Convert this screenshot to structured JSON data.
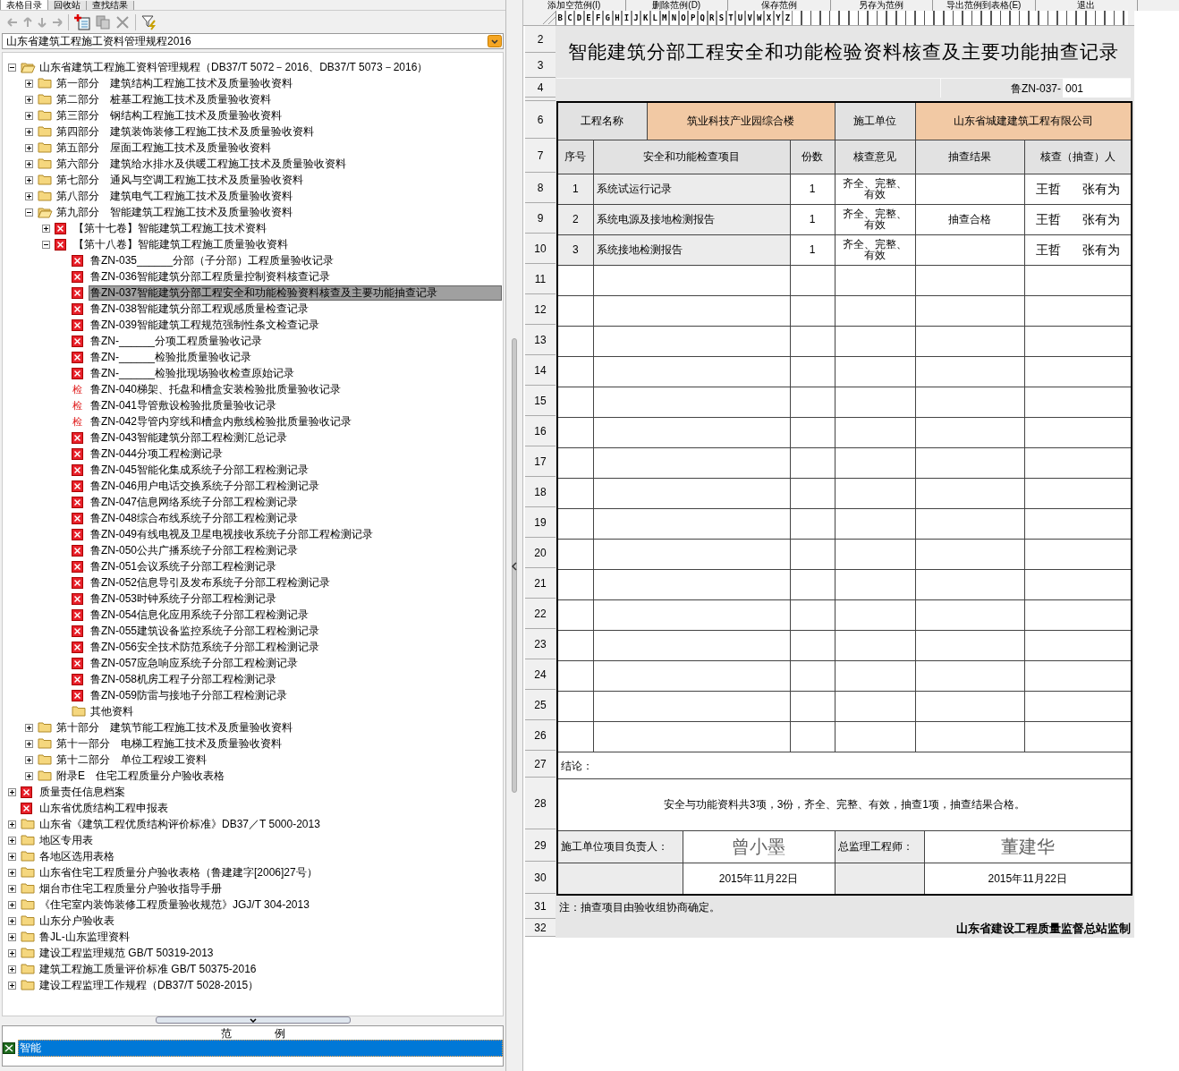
{
  "left_tabs": [
    {
      "label": "表格目录",
      "selected": true
    },
    {
      "label": "回收站",
      "selected": false
    },
    {
      "label": "查找结果",
      "selected": false
    }
  ],
  "standard_select": {
    "value": "山东省建筑工程施工资料管理规程2016"
  },
  "tree": [
    {
      "label": "山东省建筑工程施工资料管理规程（DB37/T 5072－2016、DB37/T 5073－2016）",
      "kind": "folder",
      "expanded": true,
      "selected": false,
      "children": [
        {
          "label": "第一部分　建筑结构工程施工技术及质量验收资料",
          "kind": "folder",
          "expanded": false,
          "selected": false
        },
        {
          "label": "第二部分　桩基工程施工技术及质量验收资料",
          "kind": "folder",
          "expanded": false,
          "selected": false
        },
        {
          "label": "第三部分　钢结构工程施工技术及质量验收资料",
          "kind": "folder",
          "expanded": false,
          "selected": false
        },
        {
          "label": "第四部分　建筑装饰装修工程施工技术及质量验收资料",
          "kind": "folder",
          "expanded": false,
          "selected": false
        },
        {
          "label": "第五部分　屋面工程施工技术及质量验收资料",
          "kind": "folder",
          "expanded": false,
          "selected": false
        },
        {
          "label": "第六部分　建筑给水排水及供暖工程施工技术及质量验收资料",
          "kind": "folder",
          "expanded": false,
          "selected": false
        },
        {
          "label": "第七部分　通风与空调工程施工技术及质量验收资料",
          "kind": "folder",
          "expanded": false,
          "selected": false
        },
        {
          "label": "第八部分　建筑电气工程施工技术及质量验收资料",
          "kind": "folder",
          "expanded": false,
          "selected": false
        },
        {
          "label": "第九部分　智能建筑工程施工技术及质量验收资料",
          "kind": "folder",
          "expanded": true,
          "selected": false,
          "children": [
            {
              "label": "【第十七卷】智能建筑工程施工技术资料",
              "kind": "form",
              "expanded": false,
              "selected": false
            },
            {
              "label": "【第十八卷】智能建筑工程施工质量验收资料",
              "kind": "form",
              "expanded": true,
              "selected": false,
              "children": [
                {
                  "label": "鲁ZN-035______分部（子分部）工程质量验收记录",
                  "kind": "form",
                  "selected": false
                },
                {
                  "label": "鲁ZN-036智能建筑分部工程质量控制资料核查记录",
                  "kind": "form",
                  "selected": false
                },
                {
                  "label": "鲁ZN-037智能建筑分部工程安全和功能检验资料核查及主要功能抽查记录",
                  "kind": "form",
                  "selected": true
                },
                {
                  "label": "鲁ZN-038智能建筑分部工程观感质量检查记录",
                  "kind": "form",
                  "selected": false
                },
                {
                  "label": "鲁ZN-039智能建筑工程规范强制性条文检查记录",
                  "kind": "form",
                  "selected": false
                },
                {
                  "label": "鲁ZN-______分项工程质量验收记录",
                  "kind": "form",
                  "selected": false
                },
                {
                  "label": "鲁ZN-______检验批质量验收记录",
                  "kind": "form",
                  "selected": false
                },
                {
                  "label": "鲁ZN-______检验批现场验收检查原始记录",
                  "kind": "form",
                  "selected": false
                },
                {
                  "label": "鲁ZN-040梯架、托盘和槽盒安装检验批质量验收记录",
                  "kind": "inspect",
                  "glyph": "检",
                  "selected": false
                },
                {
                  "label": "鲁ZN-041导管敷设检验批质量验收记录",
                  "kind": "inspect",
                  "glyph": "检",
                  "selected": false
                },
                {
                  "label": "鲁ZN-042导管内穿线和槽盒内敷线检验批质量验收记录",
                  "kind": "inspect",
                  "glyph": "检",
                  "selected": false
                },
                {
                  "label": "鲁ZN-043智能建筑分部工程检测汇总记录",
                  "kind": "form",
                  "selected": false
                },
                {
                  "label": "鲁ZN-044分项工程检测记录",
                  "kind": "form",
                  "selected": false
                },
                {
                  "label": "鲁ZN-045智能化集成系统子分部工程检测记录",
                  "kind": "form",
                  "selected": false
                },
                {
                  "label": "鲁ZN-046用户电话交换系统子分部工程检测记录",
                  "kind": "form",
                  "selected": false
                },
                {
                  "label": "鲁ZN-047信息网络系统子分部工程检测记录",
                  "kind": "form",
                  "selected": false
                },
                {
                  "label": "鲁ZN-048综合布线系统子分部工程检测记录",
                  "kind": "form",
                  "selected": false
                },
                {
                  "label": "鲁ZN-049有线电视及卫星电视接收系统子分部工程检测记录",
                  "kind": "form",
                  "selected": false
                },
                {
                  "label": "鲁ZN-050公共广播系统子分部工程检测记录",
                  "kind": "form",
                  "selected": false
                },
                {
                  "label": "鲁ZN-051会议系统子分部工程检测记录",
                  "kind": "form",
                  "selected": false
                },
                {
                  "label": "鲁ZN-052信息导引及发布系统子分部工程检测记录",
                  "kind": "form",
                  "selected": false
                },
                {
                  "label": "鲁ZN-053时钟系统子分部工程检测记录",
                  "kind": "form",
                  "selected": false
                },
                {
                  "label": "鲁ZN-054信息化应用系统子分部工程检测记录",
                  "kind": "form",
                  "selected": false
                },
                {
                  "label": "鲁ZN-055建筑设备监控系统子分部工程检测记录",
                  "kind": "form",
                  "selected": false
                },
                {
                  "label": "鲁ZN-056安全技术防范系统子分部工程检测记录",
                  "kind": "form",
                  "selected": false
                },
                {
                  "label": "鲁ZN-057应急响应系统子分部工程检测记录",
                  "kind": "form",
                  "selected": false
                },
                {
                  "label": "鲁ZN-058机房工程子分部工程检测记录",
                  "kind": "form",
                  "selected": false
                },
                {
                  "label": "鲁ZN-059防雷与接地子分部工程检测记录",
                  "kind": "form",
                  "selected": false
                },
                {
                  "label": "其他资料",
                  "kind": "folder",
                  "selected": false
                }
              ]
            }
          ]
        },
        {
          "label": "第十部分　建筑节能工程施工技术及质量验收资料",
          "kind": "folder",
          "expanded": false,
          "selected": false
        },
        {
          "label": "第十一部分　电梯工程施工技术及质量验收资料",
          "kind": "folder",
          "expanded": false,
          "selected": false
        },
        {
          "label": "第十二部分　单位工程竣工资料",
          "kind": "folder",
          "expanded": false,
          "selected": false
        },
        {
          "label": "附录E　住宅工程质量分户验收表格",
          "kind": "folder",
          "expanded": false,
          "selected": false
        }
      ]
    },
    {
      "label": "质量责任信息档案",
      "kind": "form",
      "expanded": false,
      "selected": false
    },
    {
      "label": "山东省优质结构工程申报表",
      "kind": "form",
      "selected": false
    },
    {
      "label": "山东省《建筑工程优质结构评价标准》DB37／T 5000-2013",
      "kind": "folder",
      "expanded": false,
      "selected": false
    },
    {
      "label": "地区专用表",
      "kind": "folder",
      "expanded": false,
      "selected": false
    },
    {
      "label": "各地区选用表格",
      "kind": "folder",
      "expanded": false,
      "selected": false
    },
    {
      "label": "山东省住宅工程质量分户验收表格（鲁建建字[2006]27号）",
      "kind": "folder",
      "expanded": false,
      "selected": false
    },
    {
      "label": "烟台市住宅工程质量分户验收指导手册",
      "kind": "folder",
      "expanded": false,
      "selected": false
    },
    {
      "label": "《住宅室内装饰装修工程质量验收规范》JGJ/T 304-2013",
      "kind": "folder",
      "expanded": false,
      "selected": false
    },
    {
      "label": "山东分户验收表",
      "kind": "folder",
      "expanded": false,
      "selected": false
    },
    {
      "label": "鲁JL-山东监理资料",
      "kind": "folder",
      "expanded": false,
      "selected": false
    },
    {
      "label": "建设工程监理规范 GB/T 50319-2013",
      "kind": "folder",
      "expanded": false,
      "selected": false
    },
    {
      "label": "建筑工程施工质量评价标准 GB/T 50375-2016",
      "kind": "folder",
      "expanded": false,
      "selected": false
    },
    {
      "label": "建设工程监理工作规程（DB37/T 5028-2015）",
      "kind": "folder",
      "expanded": false,
      "selected": false
    }
  ],
  "legend": {
    "title": "范　　　　例",
    "items": [
      {
        "label": "智能",
        "selected": true
      }
    ]
  },
  "sample_buttons": [
    "添加空范例(I)",
    "删除范例(D)",
    "保存范例",
    "另存为范例",
    "导出范例到表格(E)",
    "退出"
  ],
  "column_letters": [
    "B",
    "C",
    "D",
    "E",
    "F",
    "G",
    "H",
    "I",
    "J",
    "K",
    "L",
    "M",
    "N",
    "O",
    "P",
    "Q",
    "R",
    "S",
    "T",
    "U",
    "V",
    "W",
    "X",
    "Y",
    "Z"
  ],
  "row_numbers": [
    "2",
    "3",
    "4",
    "6",
    "7",
    "8",
    "9",
    "10",
    "11",
    "12",
    "13",
    "14",
    "15",
    "16",
    "17",
    "18",
    "19",
    "20",
    "21",
    "22",
    "23",
    "24",
    "25",
    "26",
    "27",
    "28",
    "29",
    "30",
    "31",
    "32"
  ],
  "sheet": {
    "title": "智能建筑分部工程安全和功能检验资料核查及主要功能抽查记录",
    "code_label": "鲁ZN-037-",
    "code_value": "001",
    "project_label": "工程名称",
    "project_name": "筑业科技产业园综合楼",
    "contractor_label": "施工单位",
    "contractor": "山东省城建建筑工程有限公司",
    "columns": [
      "序号",
      "安全和功能检查项目",
      "份数",
      "核查意见",
      "抽查结果",
      "核查（抽查）人"
    ],
    "rows": [
      {
        "no": "1",
        "item": "系统试运行记录",
        "copies": "1",
        "opinion": "齐全、完整、有效",
        "result": "",
        "checkers": [
          "王哲",
          "张有为"
        ]
      },
      {
        "no": "2",
        "item": "系统电源及接地检测报告",
        "copies": "1",
        "opinion": "齐全、完整、有效",
        "result": "抽查合格",
        "checkers": [
          "王哲",
          "张有为"
        ]
      },
      {
        "no": "3",
        "item": "系统接地检测报告",
        "copies": "1",
        "opinion": "齐全、完整、有效",
        "result": "",
        "checkers": [
          "王哲",
          "张有为"
        ]
      }
    ],
    "conclusion_label": "结论：",
    "conclusion": "安全与功能资料共3项，3份，齐全、完整、有效，抽查1项，抽查结果合格。",
    "signoff": [
      {
        "label": "施工单位项目负责人：",
        "signature": "曾小墨",
        "date": "2015年11月22日"
      },
      {
        "label": "总监理工程师：",
        "signature": "董建华",
        "date": "2015年11月22日"
      }
    ],
    "note": "注：抽查项目由验收组协商确定。",
    "footer": "山东省建设工程质量监督总站监制"
  }
}
